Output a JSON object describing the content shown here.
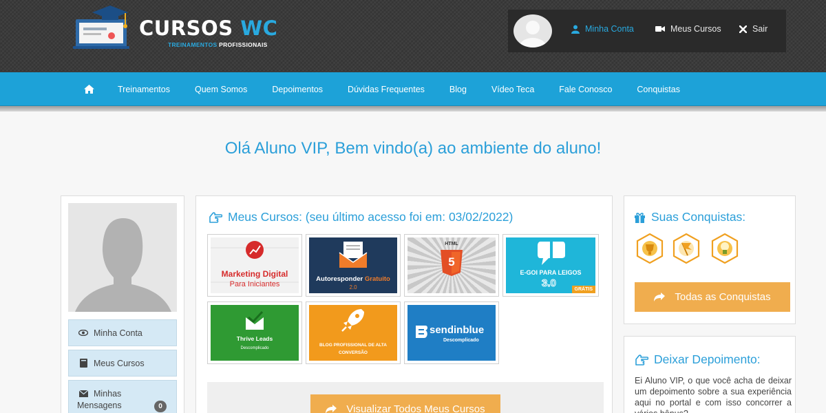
{
  "brand": {
    "name_part1": "CURSOS ",
    "name_part2": "WC",
    "tagline_part1": "TREINAMENTOS ",
    "tagline_part2": "PROFISSIONAIS"
  },
  "userbar": {
    "account": "Minha Conta",
    "courses": "Meus Cursos",
    "logout": "Sair"
  },
  "nav": {
    "items": [
      "Treinamentos",
      "Quem Somos",
      "Depoimentos",
      "Dúvidas Frequentes",
      "Blog",
      "Vídeo Teca",
      "Fale Conosco",
      "Conquistas"
    ]
  },
  "welcome": "Olá Aluno VIP, Bem vindo(a) ao ambiente do aluno!",
  "sidebar": {
    "account": "Minha Conta",
    "courses": "Meus Cursos",
    "messages_line1": "Minhas",
    "messages_line2": "Mensagens",
    "messages_count": "0"
  },
  "courses": {
    "title": "Meus Cursos: (seu último acesso foi em: 03/02/2022)",
    "view_all": "Visualizar Todos Meus Cursos",
    "items": [
      {
        "title_line1": "Marketing Digital",
        "title_line2": "Para Iniciantes",
        "bg": "#f2f2f2",
        "accent": "#d62b2b"
      },
      {
        "title_line1": "Autoresponder",
        "title_line1b": "Gratuito",
        "title_line2": "2.0",
        "bg": "#1f3a5c",
        "accent": "#f07c2a"
      },
      {
        "title_line1": "HTML",
        "title_line2": "5",
        "bg": "#dcdcdc",
        "accent": "#e34f26"
      },
      {
        "title_line1": "E-GOI PARA LEIGOS",
        "title_line2": "3.0",
        "tag": "GRÁTIS",
        "bg": "#1fb6d9",
        "accent": "#f0a020"
      },
      {
        "title_line1": "Thrive Leads",
        "title_line2": "Descomplicado",
        "bg": "#2f9a33",
        "accent": "#ffffff"
      },
      {
        "title_line1": "BLOG PROFISSIONAL DE ALTA",
        "title_line2": "CONVERSÃO",
        "bg": "#f29a1c",
        "accent": "#ffffff"
      },
      {
        "title_line1": "sendinblue",
        "title_line2": "Descomplicado",
        "bg": "#1f7ec5",
        "accent": "#ffffff"
      }
    ]
  },
  "achievements": {
    "title": "Suas Conquistas:",
    "all_button": "Todas as Conquistas"
  },
  "testimonial": {
    "title": "Deixar Depoimento:",
    "text": "Ei Aluno VIP, o que você acha de deixar um depoimento sobre a sua experiência aqui no portal e com isso concorrer a vários bônus?"
  },
  "colors": {
    "accent_blue": "#1da2d8",
    "orange": "#f0ad4e",
    "header_dark": "#3b3b3b"
  }
}
